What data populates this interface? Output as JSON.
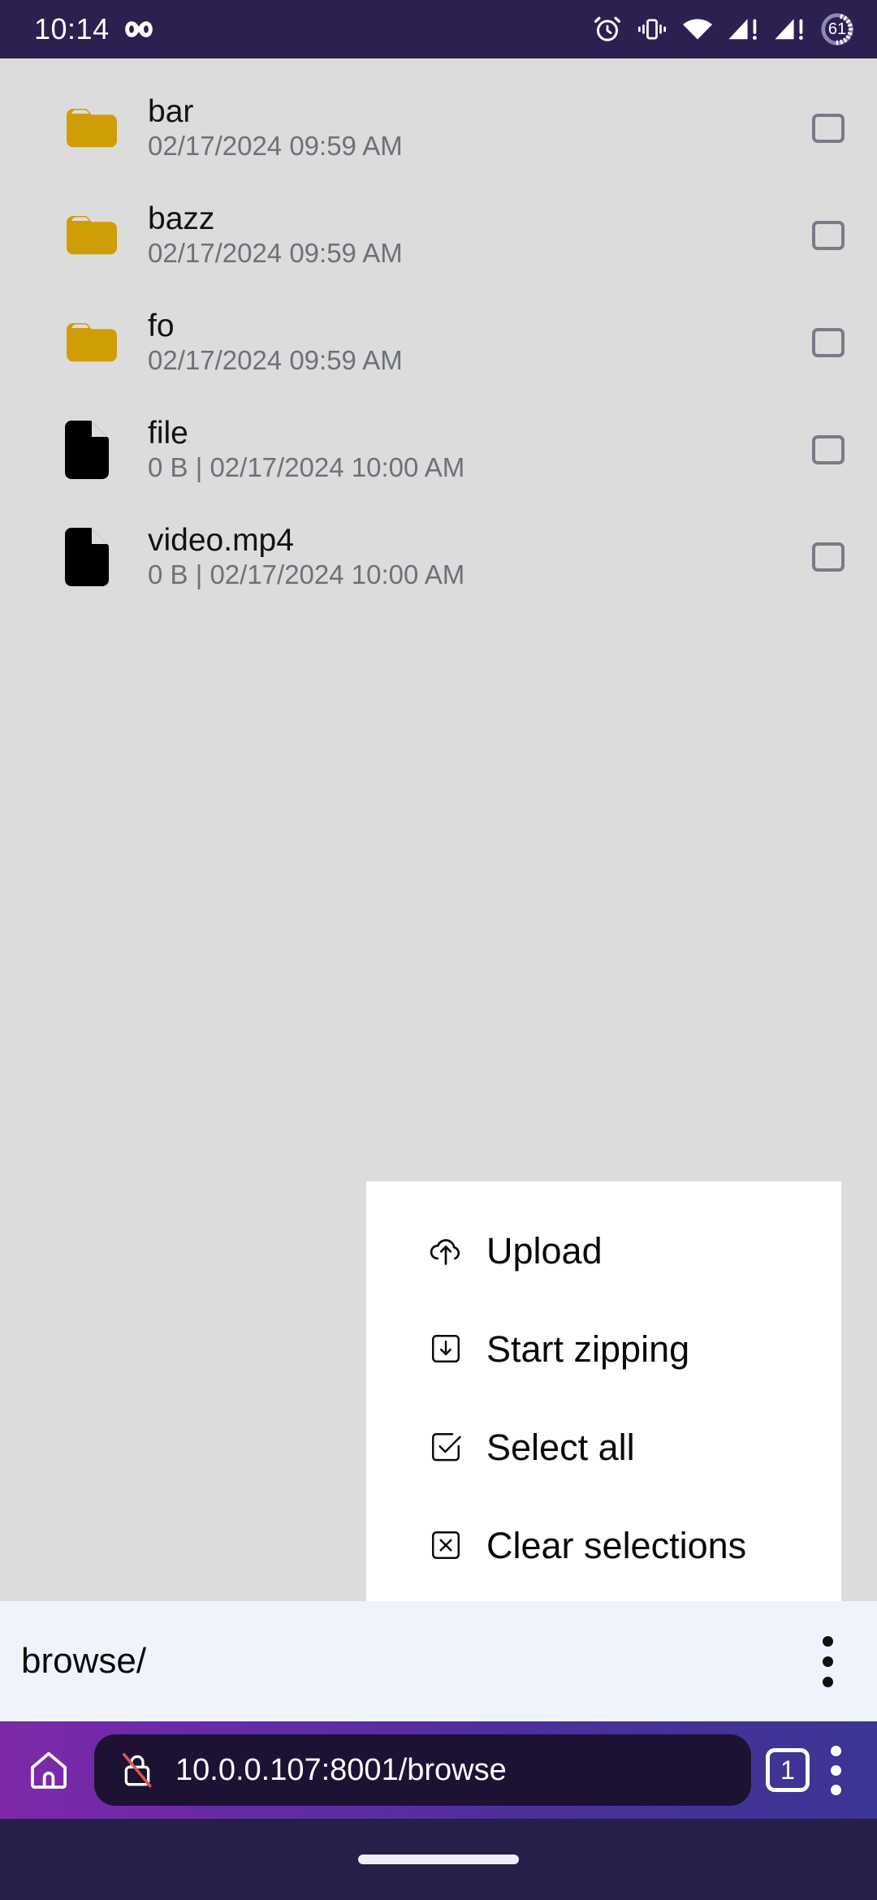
{
  "status_bar": {
    "time": "10:14",
    "infinity_icon": "infinity-icon",
    "icons": [
      "alarm-icon",
      "vibrate-icon",
      "wifi-icon",
      "signal-sim1-icon",
      "signal-sim2-icon",
      "battery-icon"
    ],
    "battery_level": "61",
    "background": "#2b2050"
  },
  "file_list": {
    "rows": [
      {
        "name": "bar",
        "meta": "02/17/2024 09:59 AM",
        "type": "folder",
        "icon": "folder-icon",
        "checked": false
      },
      {
        "name": "bazz",
        "meta": "02/17/2024 09:59 AM",
        "type": "folder",
        "icon": "folder-icon",
        "checked": false
      },
      {
        "name": "fo",
        "meta": "02/17/2024 09:59 AM",
        "type": "folder",
        "icon": "folder-icon",
        "checked": false
      },
      {
        "name": "file",
        "meta": "0 B | 02/17/2024 10:00 AM",
        "type": "file",
        "icon": "file-icon",
        "checked": false
      },
      {
        "name": "video.mp4",
        "meta": "0 B | 02/17/2024 10:00 AM",
        "type": "file",
        "icon": "file-icon",
        "checked": false
      }
    ],
    "folder_color": "#cf9e07",
    "file_color": "#000000",
    "background": "#dcdcdc"
  },
  "context_menu": {
    "items": [
      {
        "label": "Upload",
        "icon": "cloud-upload-icon"
      },
      {
        "label": "Start zipping",
        "icon": "box-download-icon"
      },
      {
        "label": "Select all",
        "icon": "checkbox-checked-icon"
      },
      {
        "label": "Clear selections",
        "icon": "box-x-icon"
      }
    ],
    "background": "#ffffff"
  },
  "browse_bar": {
    "path": "browse/",
    "menu_icon": "overflow-menu-icon",
    "background": "#eff4fc"
  },
  "browser_toolbar": {
    "home_icon": "home-icon",
    "security_icon": "lock-crossed-icon",
    "url": "10.0.0.107:8001/browse",
    "tab_count": "1",
    "menu_icon": "overflow-menu-icon",
    "gradient_start": "#7d2aa8",
    "gradient_end": "#3b3593",
    "urlbar_background": "#1d1233"
  },
  "nav_bar": {
    "gesture_pill": "gesture-pill",
    "background": "#261f4a"
  }
}
